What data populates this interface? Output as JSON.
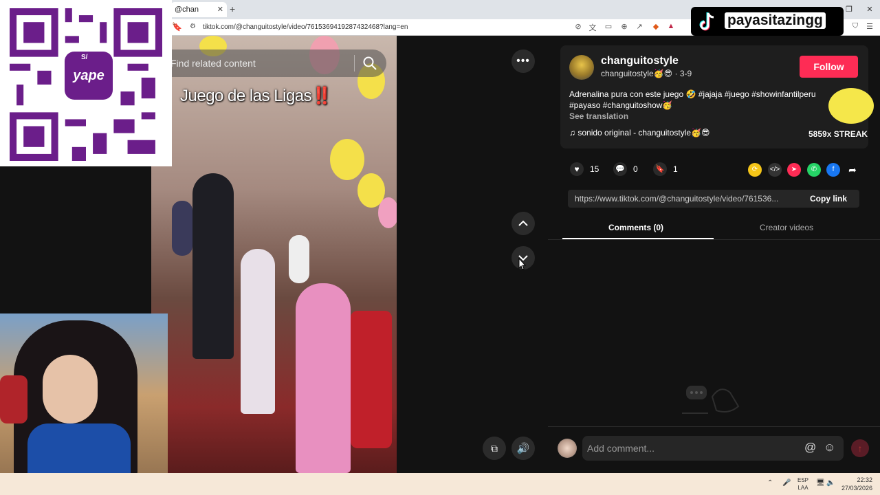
{
  "browser": {
    "tab_title": "@chan",
    "url": "tiktok.com/@changuitostyle/video/7615369419287432468?lang=en",
    "window_controls": [
      "—",
      "❐",
      "✕"
    ]
  },
  "search": {
    "placeholder": "Find related content"
  },
  "video": {
    "title_text": "Juego de las Ligas",
    "title_emoji": "‼️"
  },
  "post": {
    "username": "changuitostyle",
    "nickname": "changuitostyle🥳😎 · 3-9",
    "follow_label": "Follow",
    "description": "Adrenalina pura con este juego 🤣 #jajaja #juego #showinfantilperu #payaso #changuitoshow🥳",
    "see_translation": "See translation",
    "music": "sonido original - changuitostyle🥳😎",
    "likes": "15",
    "comments": "0",
    "saves": "1",
    "link": "https://www.tiktok.com/@changuitostyle/video/761536...",
    "copy_link": "Copy link"
  },
  "tabs": {
    "comments": "Comments (0)",
    "creator": "Creator videos"
  },
  "comment_box": {
    "placeholder": "Add comment..."
  },
  "overlay": {
    "channel_name": "payasitazingg",
    "streak": "5859x STREAK",
    "qr_brand": "yape",
    "qr_currency": "S/"
  },
  "taskbar": {
    "lang_top": "ESP",
    "lang_bottom": "LAA",
    "time": "22:32",
    "date": "27/03/2026"
  },
  "colors": {
    "follow": "#fe2c55",
    "panel_bg": "#121212",
    "yape": "#6b1e8a"
  }
}
